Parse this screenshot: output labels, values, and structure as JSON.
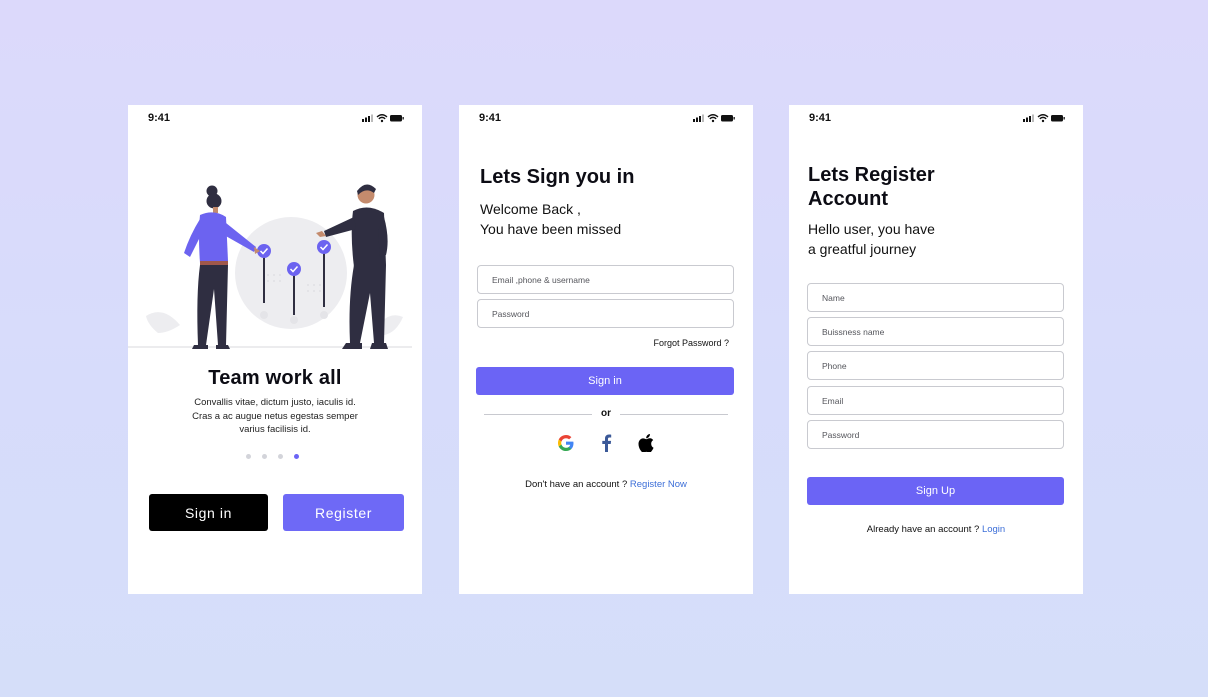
{
  "status_bar": {
    "time": "9:41"
  },
  "onboarding": {
    "title": "Team work all",
    "description_lines": [
      "Convallis vitae, dictum justo, iaculis id.",
      "Cras a ac augue netus egestas semper",
      "varius facilisis id."
    ],
    "pagination": {
      "count": 4,
      "active_index": 3
    },
    "sign_in_label": "Sign in",
    "register_label": "Register"
  },
  "sign_in": {
    "title": "Lets Sign you in",
    "subtitle_lines": [
      "Welcome Back ,",
      "You have been missed"
    ],
    "email_placeholder": "Email ,phone & username",
    "password_placeholder": "Password",
    "forgot_label": "Forgot Password ?",
    "submit_label": "Sign in",
    "divider_label": "or",
    "social_icons": [
      "google-icon",
      "facebook-icon",
      "apple-icon"
    ],
    "footer_text": "Don't have an account ?",
    "footer_link": "Register Now"
  },
  "register": {
    "title_lines": [
      "Lets Register",
      "Account"
    ],
    "subtitle_lines": [
      "Hello user, you have",
      "a greatful journey"
    ],
    "fields": [
      {
        "placeholder": "Name"
      },
      {
        "placeholder": "Buissness name"
      },
      {
        "placeholder": "Phone"
      },
      {
        "placeholder": "Email"
      },
      {
        "placeholder": "Password"
      }
    ],
    "submit_label": "Sign Up",
    "footer_text": "Already  have an account ?",
    "footer_link": "Login"
  },
  "colors": {
    "accent": "#6b64f5",
    "link": "#3d6fd8",
    "illustration_purple": "#6c63f0",
    "dark_figure": "#2f2e41"
  }
}
